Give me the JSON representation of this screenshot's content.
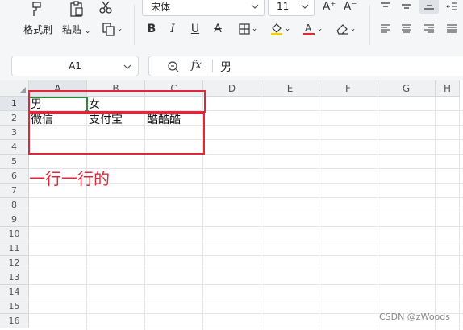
{
  "toolbar": {
    "format_painter_label": "格式刷",
    "paste_label": "粘贴",
    "font_name": "宋体",
    "font_size": "11"
  },
  "formula_bar": {
    "name_box": "A1",
    "fx_label": "fx",
    "content": "男"
  },
  "sheet": {
    "columns": [
      "A",
      "B",
      "C",
      "D",
      "E",
      "F",
      "G",
      "H"
    ],
    "rows": [
      "1",
      "2",
      "3",
      "4",
      "5",
      "6",
      "7",
      "8",
      "9",
      "10",
      "11",
      "12",
      "13",
      "14",
      "15",
      "16"
    ],
    "active_cell": "A1",
    "cells": {
      "A1": "男",
      "B1": "女",
      "A2": "微信",
      "B2": "支付宝",
      "C2": "酷酷酷"
    }
  },
  "annotation": {
    "text": "一行一行的",
    "color": "#e0283a"
  },
  "watermark": "CSDN @zWoods",
  "colors": {
    "selection": "#2f8a3a",
    "font_color_bar": "#e0283a",
    "fill_color_bar": "#f2d000"
  }
}
